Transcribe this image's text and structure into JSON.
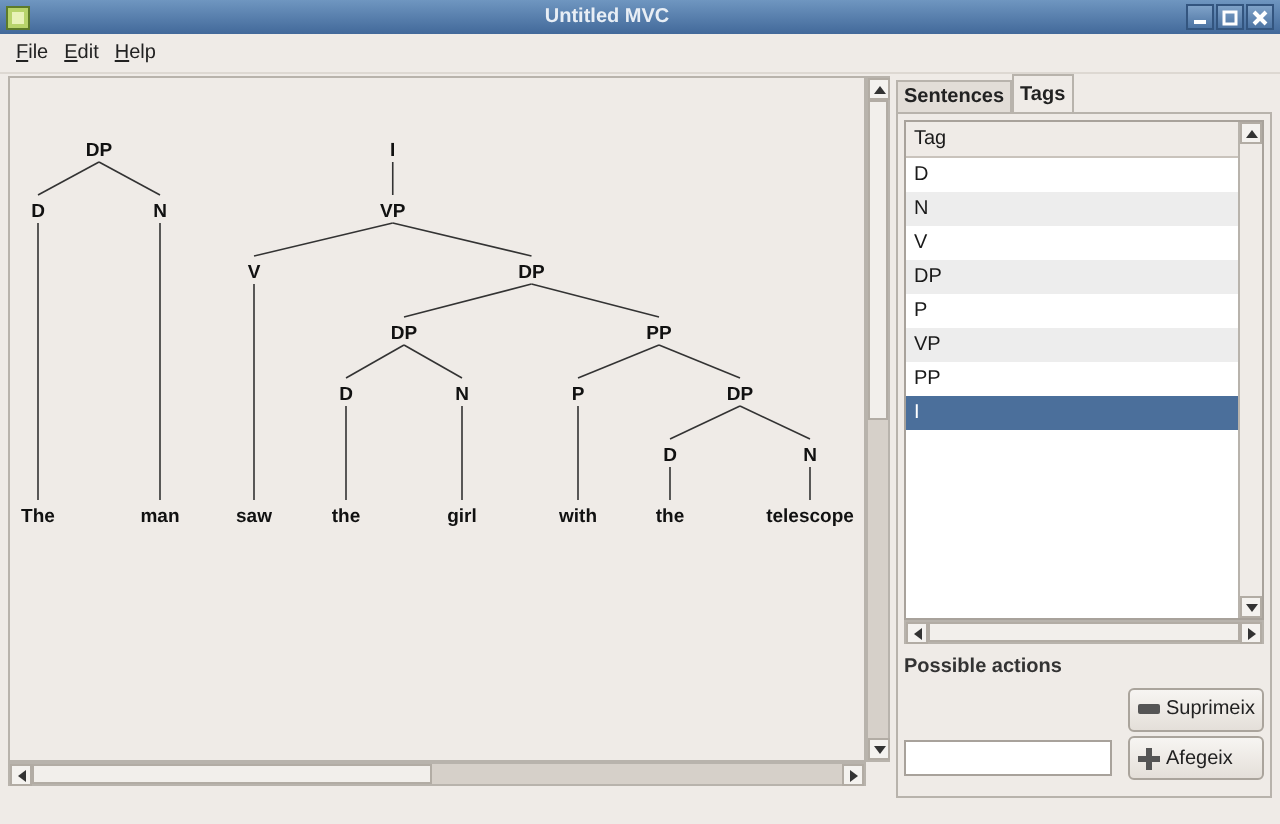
{
  "window": {
    "title": "Untitled MVC"
  },
  "menu": [
    "File",
    "Edit",
    "Help"
  ],
  "tree": {
    "roots": [
      {
        "label": "DP",
        "children": [
          {
            "label": "D",
            "children": [
              {
                "label": "The"
              }
            ]
          },
          {
            "label": "N",
            "children": [
              {
                "label": "man"
              }
            ]
          }
        ]
      },
      {
        "label": "I",
        "children": [
          {
            "label": "VP",
            "children": [
              {
                "label": "V",
                "children": [
                  {
                    "label": "saw"
                  }
                ]
              },
              {
                "label": "DP",
                "children": [
                  {
                    "label": "DP",
                    "children": [
                      {
                        "label": "D",
                        "children": [
                          {
                            "label": "the"
                          }
                        ]
                      },
                      {
                        "label": "N",
                        "children": [
                          {
                            "label": "girl"
                          }
                        ]
                      }
                    ]
                  },
                  {
                    "label": "PP",
                    "children": [
                      {
                        "label": "P",
                        "children": [
                          {
                            "label": "with"
                          }
                        ]
                      },
                      {
                        "label": "DP",
                        "children": [
                          {
                            "label": "D",
                            "children": [
                              {
                                "label": "the"
                              }
                            ]
                          },
                          {
                            "label": "N",
                            "children": [
                              {
                                "label": "telescope"
                              }
                            ]
                          }
                        ]
                      }
                    ]
                  }
                ]
              }
            ]
          }
        ]
      }
    ]
  },
  "tabs": [
    {
      "label": "Sentences",
      "selected": false
    },
    {
      "label": "Tags",
      "selected": true
    }
  ],
  "table": {
    "columns": [
      "Tag"
    ],
    "rows": [
      {
        "tag": "D",
        "selected": false
      },
      {
        "tag": "N",
        "selected": false
      },
      {
        "tag": "V",
        "selected": false
      },
      {
        "tag": "DP",
        "selected": false
      },
      {
        "tag": "P",
        "selected": false
      },
      {
        "tag": "VP",
        "selected": false
      },
      {
        "tag": "PP",
        "selected": false
      },
      {
        "tag": "I",
        "selected": true
      }
    ]
  },
  "actions": {
    "title": "Possible actions",
    "remove_button": "Suprimeix",
    "add_button": "Afegeix"
  }
}
